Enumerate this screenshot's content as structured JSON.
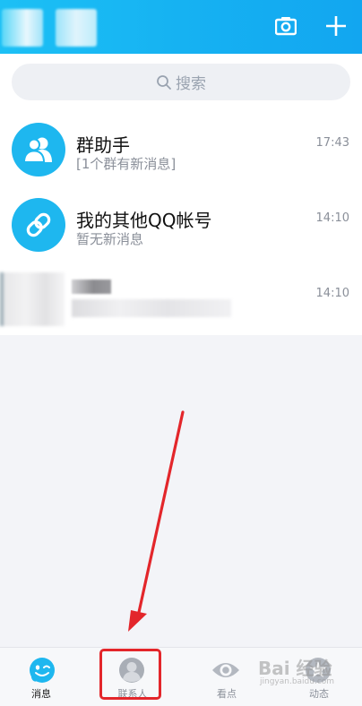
{
  "header": {
    "camera_icon": "camera-icon",
    "add_icon": "plus-icon"
  },
  "search": {
    "icon": "search-icon",
    "placeholder": "搜索"
  },
  "chats": [
    {
      "name": "群助手",
      "subtitle": "[1个群有新消息]",
      "time": "17:43",
      "icon": "group-icon"
    },
    {
      "name": "我的其他QQ帐号",
      "subtitle": "暂无新消息",
      "time": "14:10",
      "icon": "link-icon"
    },
    {
      "name": "",
      "subtitle": "",
      "time": "14:10",
      "icon": "avatar"
    }
  ],
  "tabbar": {
    "tabs": [
      {
        "label": "消息",
        "icon": "message-penguin-icon",
        "active": true
      },
      {
        "label": "联系人",
        "icon": "contacts-icon",
        "active": false
      },
      {
        "label": "看点",
        "icon": "eye-icon",
        "active": false
      },
      {
        "label": "动态",
        "icon": "star-icon",
        "active": false
      }
    ]
  },
  "watermark": {
    "text": "Bai 经验",
    "sub": "jingyan.baidu.com"
  },
  "colors": {
    "brand": "#12b7f5",
    "annotation": "#e3262b"
  }
}
